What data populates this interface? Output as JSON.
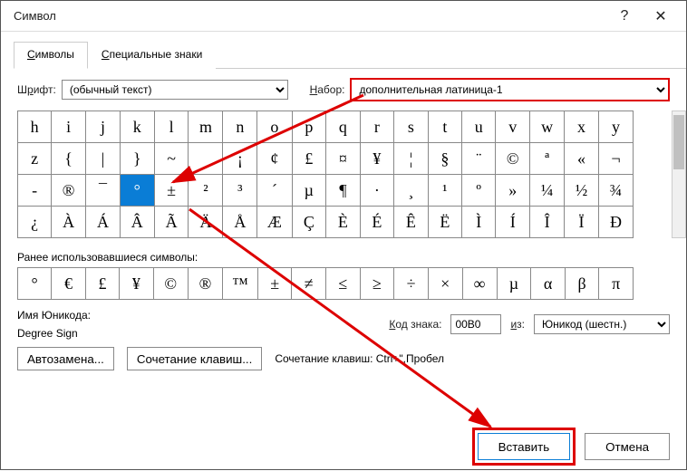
{
  "titlebar": {
    "title": "Символ",
    "help": "?",
    "close": "✕"
  },
  "tabs": {
    "symbols": "Символы",
    "special": "Специальные знаки"
  },
  "font": {
    "label_pre": "Ш",
    "label_u": "р",
    "label_post": "ифт:",
    "value": "(обычный текст)"
  },
  "set": {
    "label_pre": "",
    "label_u": "Н",
    "label_post": "абор:",
    "value": "дополнительная латиница-1"
  },
  "grid": [
    [
      "h",
      "i",
      "j",
      "k",
      "l",
      "m",
      "n",
      "o",
      "p",
      "q",
      "r",
      "s",
      "t",
      "u",
      "v",
      "w",
      "x",
      "y"
    ],
    [
      "z",
      "{",
      "|",
      "}",
      "~",
      "",
      "¡",
      "¢",
      "£",
      "¤",
      "¥",
      "¦",
      "§",
      "¨",
      "©",
      "ª",
      "«",
      "¬"
    ],
    [
      "-",
      "®",
      "¯",
      "°",
      "±",
      "²",
      "³",
      "´",
      "µ",
      "¶",
      "·",
      "¸",
      "¹",
      "º",
      "»",
      "¼",
      "½",
      "¾"
    ],
    [
      "¿",
      "À",
      "Á",
      "Â",
      "Ã",
      "Ä",
      "Å",
      "Æ",
      "Ç",
      "È",
      "É",
      "Ê",
      "Ë",
      "Ì",
      "Í",
      "Î",
      "Ï",
      "Ð"
    ]
  ],
  "grid_selected": {
    "row": 2,
    "col": 3
  },
  "recent": {
    "label_u": "Р",
    "label_post": "анее использовавшиеся символы:"
  },
  "recent_grid": [
    "°",
    "€",
    "£",
    "¥",
    "©",
    "®",
    "™",
    "±",
    "≠",
    "≤",
    "≥",
    "÷",
    "×",
    "∞",
    "µ",
    "α",
    "β",
    "π"
  ],
  "unicode_name": {
    "label": "Имя Юникода:",
    "value": "Degree Sign"
  },
  "charcode": {
    "label_u": "К",
    "label_post": "од знака:",
    "value": "00B0"
  },
  "from": {
    "label_u": "и",
    "label_post": "з:",
    "value": "Юникод (шестн.)"
  },
  "autocorrect": {
    "label": "Автозамена..."
  },
  "shortcut_btn": {
    "label": "Сочетание клавиш..."
  },
  "shortcut_info": {
    "label": "Сочетание клавиш: Ctrl+\",Пробел"
  },
  "insert": {
    "label": "Вставить"
  },
  "cancel": {
    "label": "Отмена"
  }
}
